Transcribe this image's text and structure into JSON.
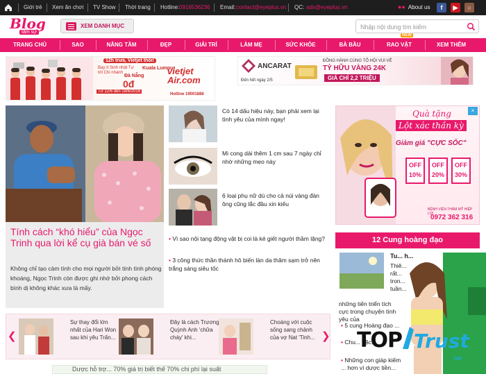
{
  "topbar": {
    "links": [
      "Giới trẻ",
      "Xem ăn chơi",
      "TV Show",
      "Thời trang"
    ],
    "hotline_label": "Hotline:",
    "hotline_value": "0916536236",
    "email_label": "Email:",
    "email_value": "contact@eyeplus.vn",
    "qc_label": "QC:",
    "qc_value": "ads@eyeplus.vn",
    "about": "About us"
  },
  "header": {
    "logo_text": "Blog",
    "logo_sub": "tâm sự",
    "category_button": "XEM DANH MỤC",
    "search_placeholder": "Nhập nội dung tìm kiếm"
  },
  "nav": {
    "items": [
      "TRANG CHỦ",
      "SAO",
      "NÂNG TẦM",
      "ĐẸP",
      "GIẢI TRÍ",
      "LÀM MẸ",
      "SỨC KHỎE",
      "BÀ BẦU",
      "RAO VẶT",
      "XEM THÊM"
    ],
    "new_badge": "NEW"
  },
  "ads": {
    "vietjet": {
      "headline": "12h trưa, Vietjet thôi!",
      "sub": "Bay ít Sinh nhật Tự tới Chi nhánh",
      "route1": "Kuala Lumpur",
      "route2": "Đà Nẵng",
      "price": "0đ",
      "date": "Từ 12/6 đến 18/6/2016",
      "brand": "vietjet Air.com",
      "hotline": "Hotline 19001886"
    },
    "ancarat": {
      "brand": "ANCARAT",
      "line1": "ĐỒNG HÀNH CÙNG TỔ HỘI VUI VẺ",
      "line2": "TỶ HỮU VÀNG 24K",
      "line3": "GIÁ CHỈ 2,2 TRIỆU",
      "footer": "Đến hết ngày 2/5"
    },
    "qua_tang": {
      "title": "Quà tặng",
      "line1": "Lột xác thần kỳ",
      "line2": "Giảm giá \"CỰC SỐC\"",
      "tag1": "OFF 10%",
      "tag2": "OFF 20%",
      "tag3": "OFF 30%",
      "clinic": "BỆNH VIỆN THẨM MỸ HIỆP LỢI",
      "phone": "0972 362 316"
    },
    "bottom": "Dược hỗ trợ... 70% giá trị biết thế 70% chi phí lại suất"
  },
  "lead": {
    "title": "Tính cách “khó hiểu” của Ngọc Trinh qua lời kể cụ già bán vé số",
    "summary": "Không chỉ tạo cảm tình cho mọi người bởi tính tình phóng khoáng, Ngọc Trinh còn được ghi nhớ bởi phong cách bình dị không khác xưa là mấy."
  },
  "mid": {
    "items": [
      "Có 14 dấu hiệu này, bạn phải xem lại tình yêu của mình ngay!",
      "Mi cong dài thêm 1 cm sau 7 ngày chỉ nhờ những mẹo này",
      "6 loại phụ nữ dù cho cả núi vàng đàn ông cũng lắc đầu xin kiếu"
    ],
    "bullets": [
      "Vì sao nội tạng động vật bị coi là kẻ giết người thầm lặng?",
      "3 công thức thần thánh hô biến làn da thâm sạm trở nên trắng sáng siêu tốc"
    ]
  },
  "zodiac": {
    "header": "12 Cung hoàng đạo",
    "lead_title": "Tu... h...",
    "lead_text": "Thiê... rất... tron... tuần...",
    "lead_more": "những tiến triển tích cực trong chuyện tình yêu của",
    "items": [
      "5 cung Hoàng đạo ...",
      "Chu... đặc...",
      "Những con giáp kiếm ... hơn ví dược tiền..."
    ]
  },
  "carousel": {
    "items": [
      "Sự thay đổi lớn nhất của Hari Won sau khi yêu Trấn...",
      "Đây là cách Trương Quỳnh Anh 'chữa cháy' khi...",
      "Choáng với cuộc sống sang chảnh của vợ Nat 'Tinh..."
    ]
  },
  "overlay": {
    "brand_top": "TOP",
    "brand_trust": "Trust",
    "brand_domain": ".vn"
  },
  "colors": {
    "brand": "#e8196b",
    "topbar": "#1e1e1e",
    "link_pink": "#e8196b"
  }
}
